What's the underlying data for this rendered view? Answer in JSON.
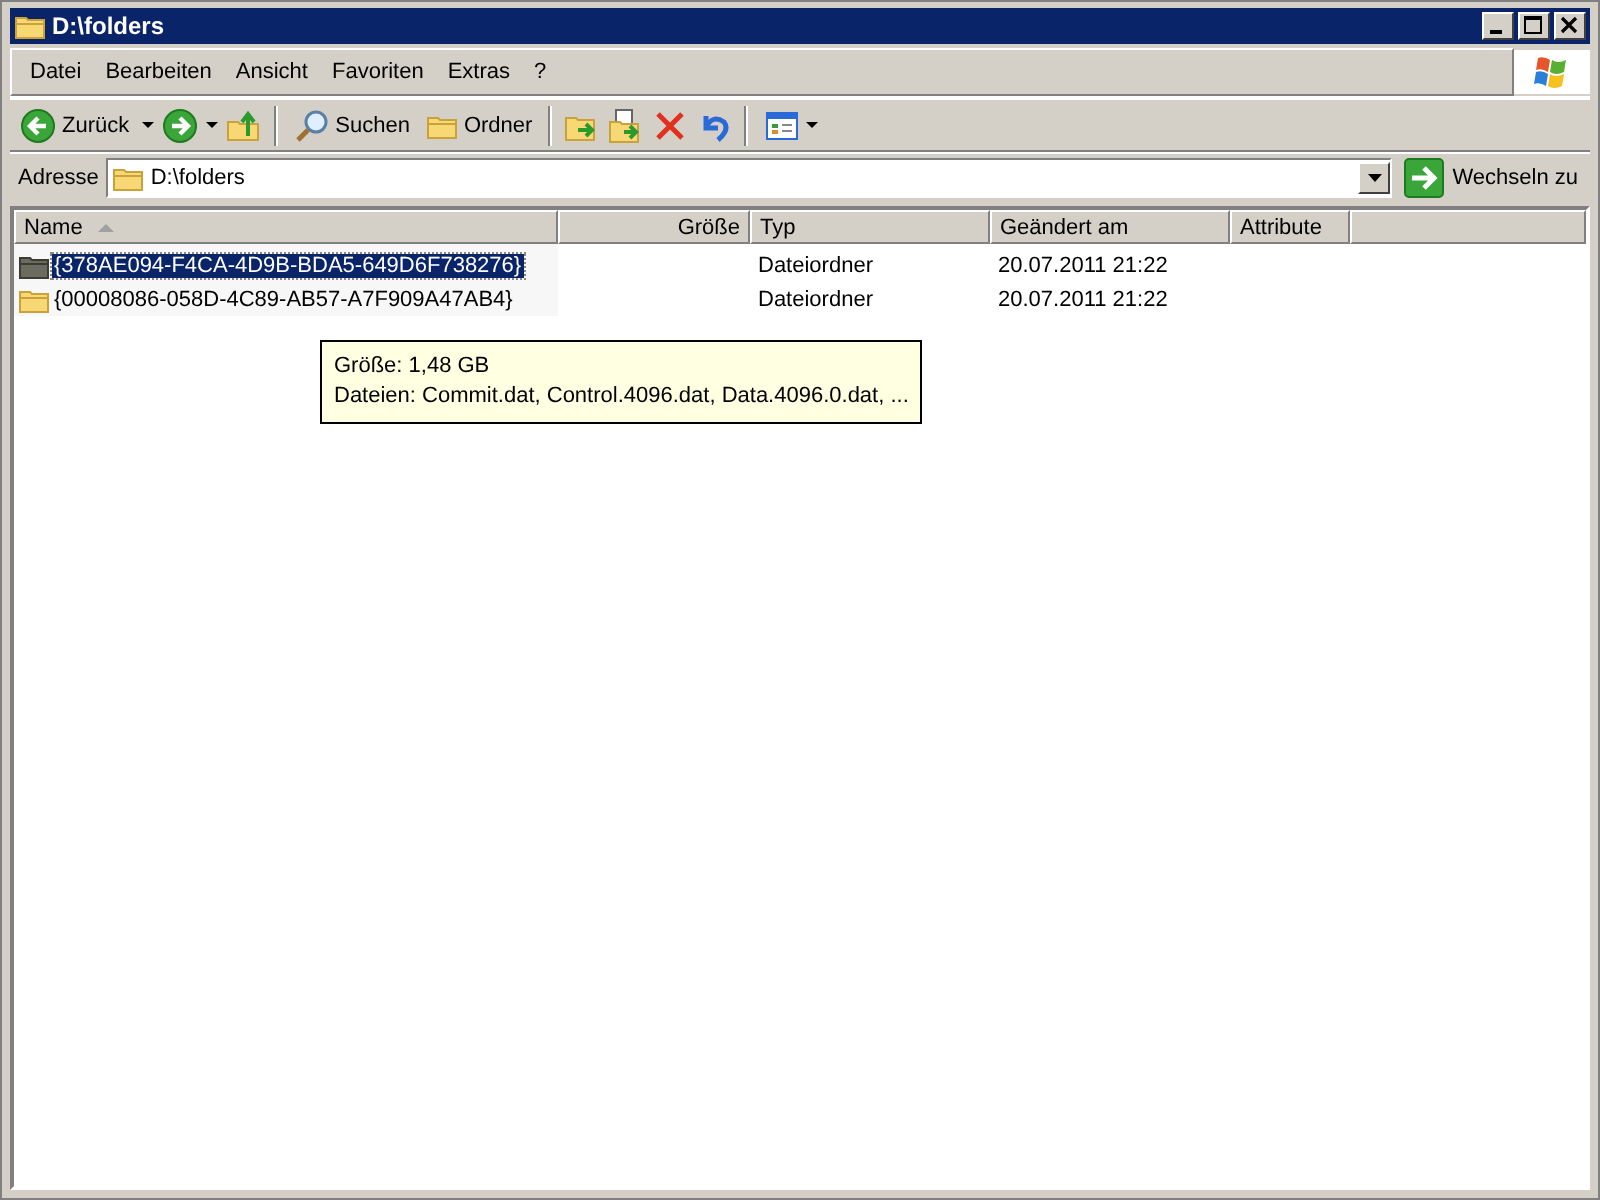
{
  "window": {
    "title": "D:\\folders"
  },
  "menu": [
    "Datei",
    "Bearbeiten",
    "Ansicht",
    "Favoriten",
    "Extras",
    "?"
  ],
  "toolbar": {
    "back": "Zurück",
    "search": "Suchen",
    "folders": "Ordner"
  },
  "address": {
    "label": "Adresse",
    "value": "D:\\folders",
    "go": "Wechseln zu"
  },
  "table": {
    "columns": [
      {
        "label": "Name",
        "sorted": true,
        "kind": "text"
      },
      {
        "label": "Größe",
        "sorted": false,
        "kind": "number"
      },
      {
        "label": "Typ",
        "sorted": false,
        "kind": "text"
      },
      {
        "label": "Geändert am",
        "sorted": false,
        "kind": "text"
      },
      {
        "label": "Attribute",
        "sorted": false,
        "kind": "text"
      }
    ],
    "rows": [
      {
        "selected": true,
        "cells": [
          "{378AE094-F4CA-4D9B-BDA5-649D6F738276}",
          "",
          "Dateiordner",
          "20.07.2011 21:22",
          ""
        ]
      },
      {
        "selected": false,
        "cells": [
          "{00008086-058D-4C89-AB57-A7F909A47AB4}",
          "",
          "Dateiordner",
          "20.07.2011 21:22",
          ""
        ]
      }
    ]
  },
  "tooltip": {
    "lines": [
      "Größe: 1,48 GB",
      "Dateien: Commit.dat, Control.4096.dat, Data.4096.0.dat, ..."
    ]
  }
}
